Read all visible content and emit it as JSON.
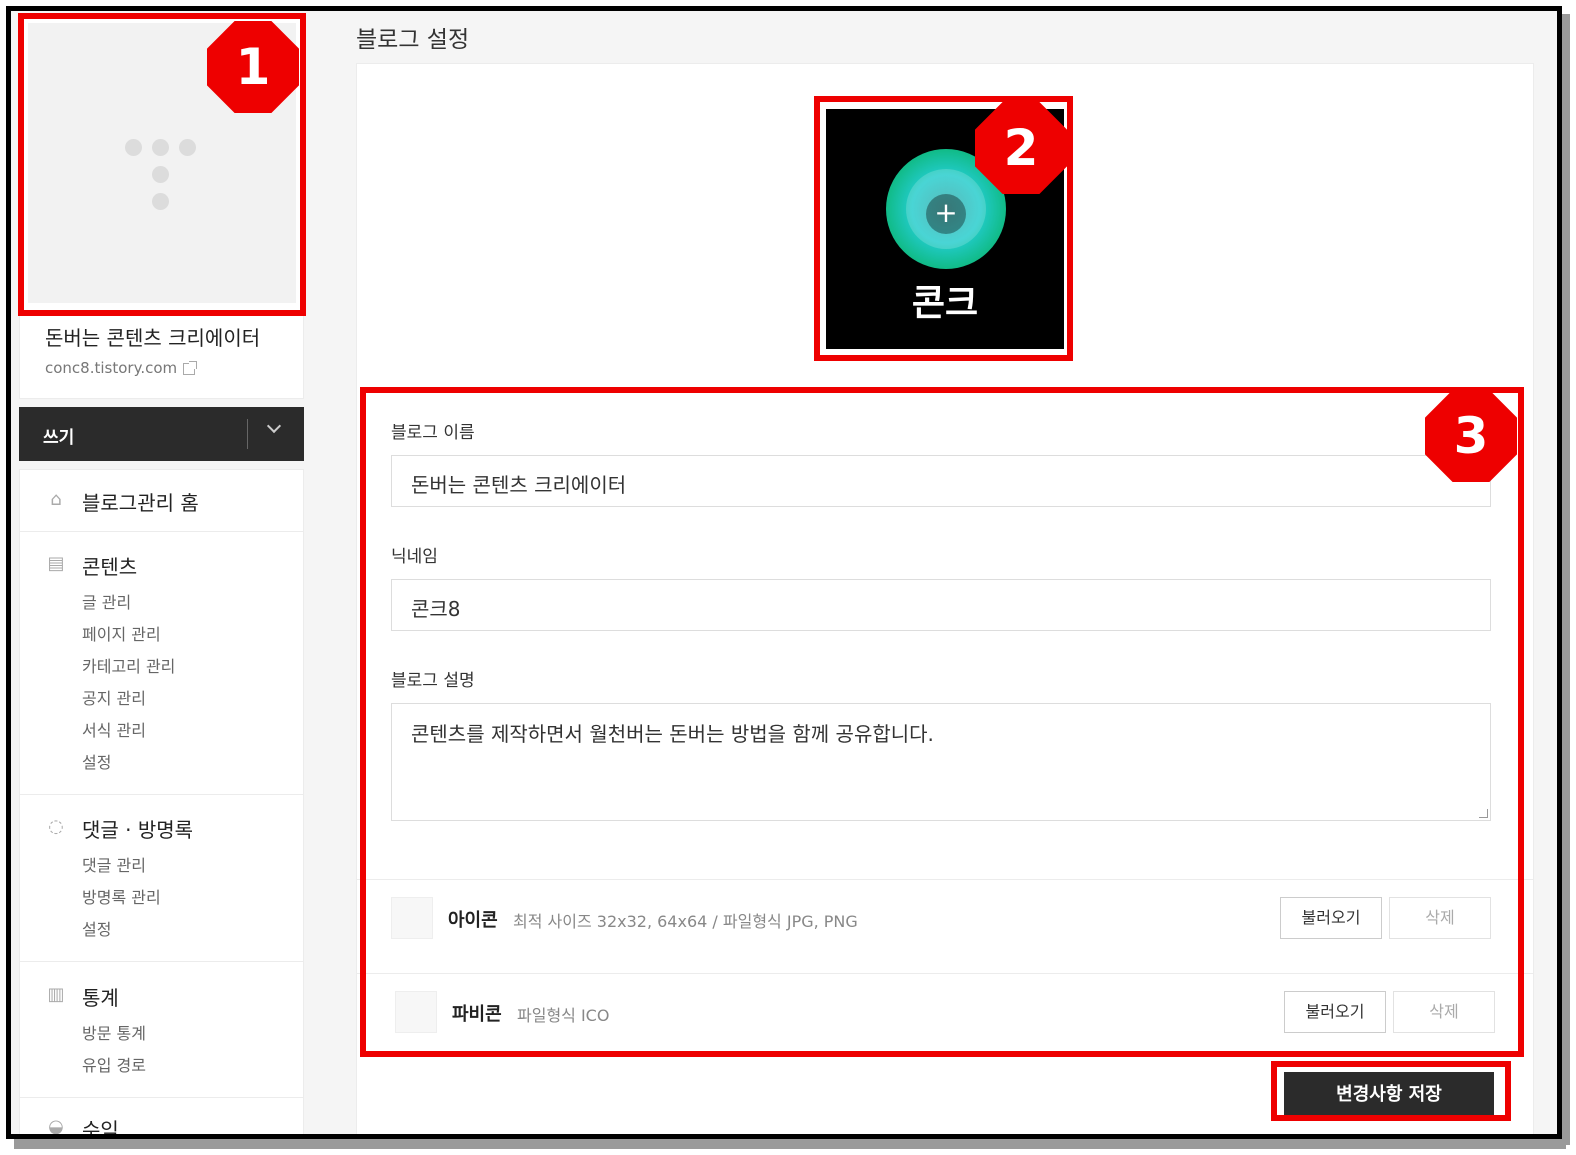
{
  "page_title": "블로그 설정",
  "blog": {
    "title": "돈버는 콘텐츠 크리에이터",
    "url": "conc8.tistory.com"
  },
  "write": {
    "label": "쓰기"
  },
  "menu": {
    "home": "블로그관리 홈",
    "content": {
      "title": "콘텐츠",
      "items": [
        "글 관리",
        "페이지 관리",
        "카테고리 관리",
        "공지 관리",
        "서식 관리",
        "설정"
      ]
    },
    "comments": {
      "title": "댓글 · 방명록",
      "items": [
        "댓글 관리",
        "방명록 관리",
        "설정"
      ]
    },
    "stats": {
      "title": "통계",
      "items": [
        "방문 통계",
        "유입 경로"
      ]
    },
    "revenue": {
      "title": "수익"
    }
  },
  "logo": {
    "text": "콘크"
  },
  "form": {
    "name_label": "블로그 이름",
    "name_value": "돈버는 콘텐츠 크리에이터",
    "nickname_label": "닉네임",
    "nickname_value": "콘크8",
    "desc_label": "블로그 설명",
    "desc_value": "콘텐츠를 제작하면서 월천버는 돈버는 방법을 함께 공유합니다."
  },
  "icon_row": {
    "label": "아이콘",
    "desc": "최적 사이즈 32x32, 64x64 / 파일형식 JPG, PNG",
    "load": "불러오기",
    "delete": "삭제"
  },
  "favicon_row": {
    "label": "파비콘",
    "desc": "파일형식 ICO",
    "load": "불러오기",
    "delete": "삭제"
  },
  "save_label": "변경사항 저장",
  "annotations": [
    "1",
    "2",
    "3"
  ],
  "colors": {
    "annotation": "#ee0000",
    "dark_button": "#2b2b2b"
  }
}
